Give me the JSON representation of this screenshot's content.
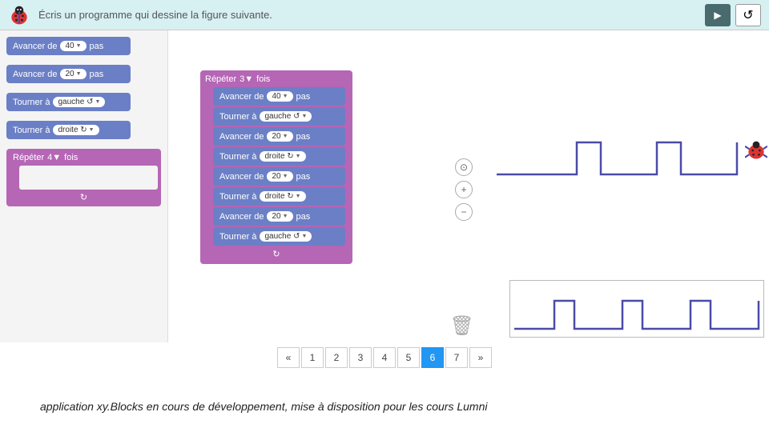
{
  "header": {
    "instruction": "Écris un programme qui dessine la figure suivante.",
    "play_icon": "▶",
    "reset_icon": "↺"
  },
  "palette": {
    "move1": {
      "label_pre": "Avancer de",
      "value": "40",
      "label_post": "pas"
    },
    "move2": {
      "label_pre": "Avancer de",
      "value": "20",
      "label_post": "pas"
    },
    "turn1": {
      "label_pre": "Tourner à",
      "value": "gauche ↺"
    },
    "turn2": {
      "label_pre": "Tourner à",
      "value": "droite ↻"
    },
    "repeat": {
      "label_pre": "Répéter",
      "value": "4",
      "label_post": "fois",
      "loop_icon": "↻"
    }
  },
  "workspace": {
    "repeat": {
      "label_pre": "Répéter",
      "value": "3",
      "label_post": "fois",
      "loop_icon": "↻"
    },
    "steps": [
      {
        "type": "move",
        "pre": "Avancer de",
        "val": "40",
        "post": "pas"
      },
      {
        "type": "turn",
        "pre": "Tourner à",
        "val": "gauche ↺"
      },
      {
        "type": "move",
        "pre": "Avancer de",
        "val": "20",
        "post": "pas"
      },
      {
        "type": "turn",
        "pre": "Tourner à",
        "val": "droite ↻"
      },
      {
        "type": "move",
        "pre": "Avancer de",
        "val": "20",
        "post": "pas"
      },
      {
        "type": "turn",
        "pre": "Tourner à",
        "val": "droite ↻"
      },
      {
        "type": "move",
        "pre": "Avancer de",
        "val": "20",
        "post": "pas"
      },
      {
        "type": "turn",
        "pre": "Tourner à",
        "val": "gauche ↺"
      }
    ]
  },
  "controls": {
    "center": "⊙",
    "zoom_in": "+",
    "zoom_out": "−",
    "trash": "🗑"
  },
  "pagination": {
    "prev": "«",
    "pages": [
      "1",
      "2",
      "3",
      "4",
      "5",
      "6",
      "7"
    ],
    "active": "6",
    "next": "»"
  },
  "caption": "application xy.Blocks en cours de développement, mise à disposition pour les cours Lumni"
}
